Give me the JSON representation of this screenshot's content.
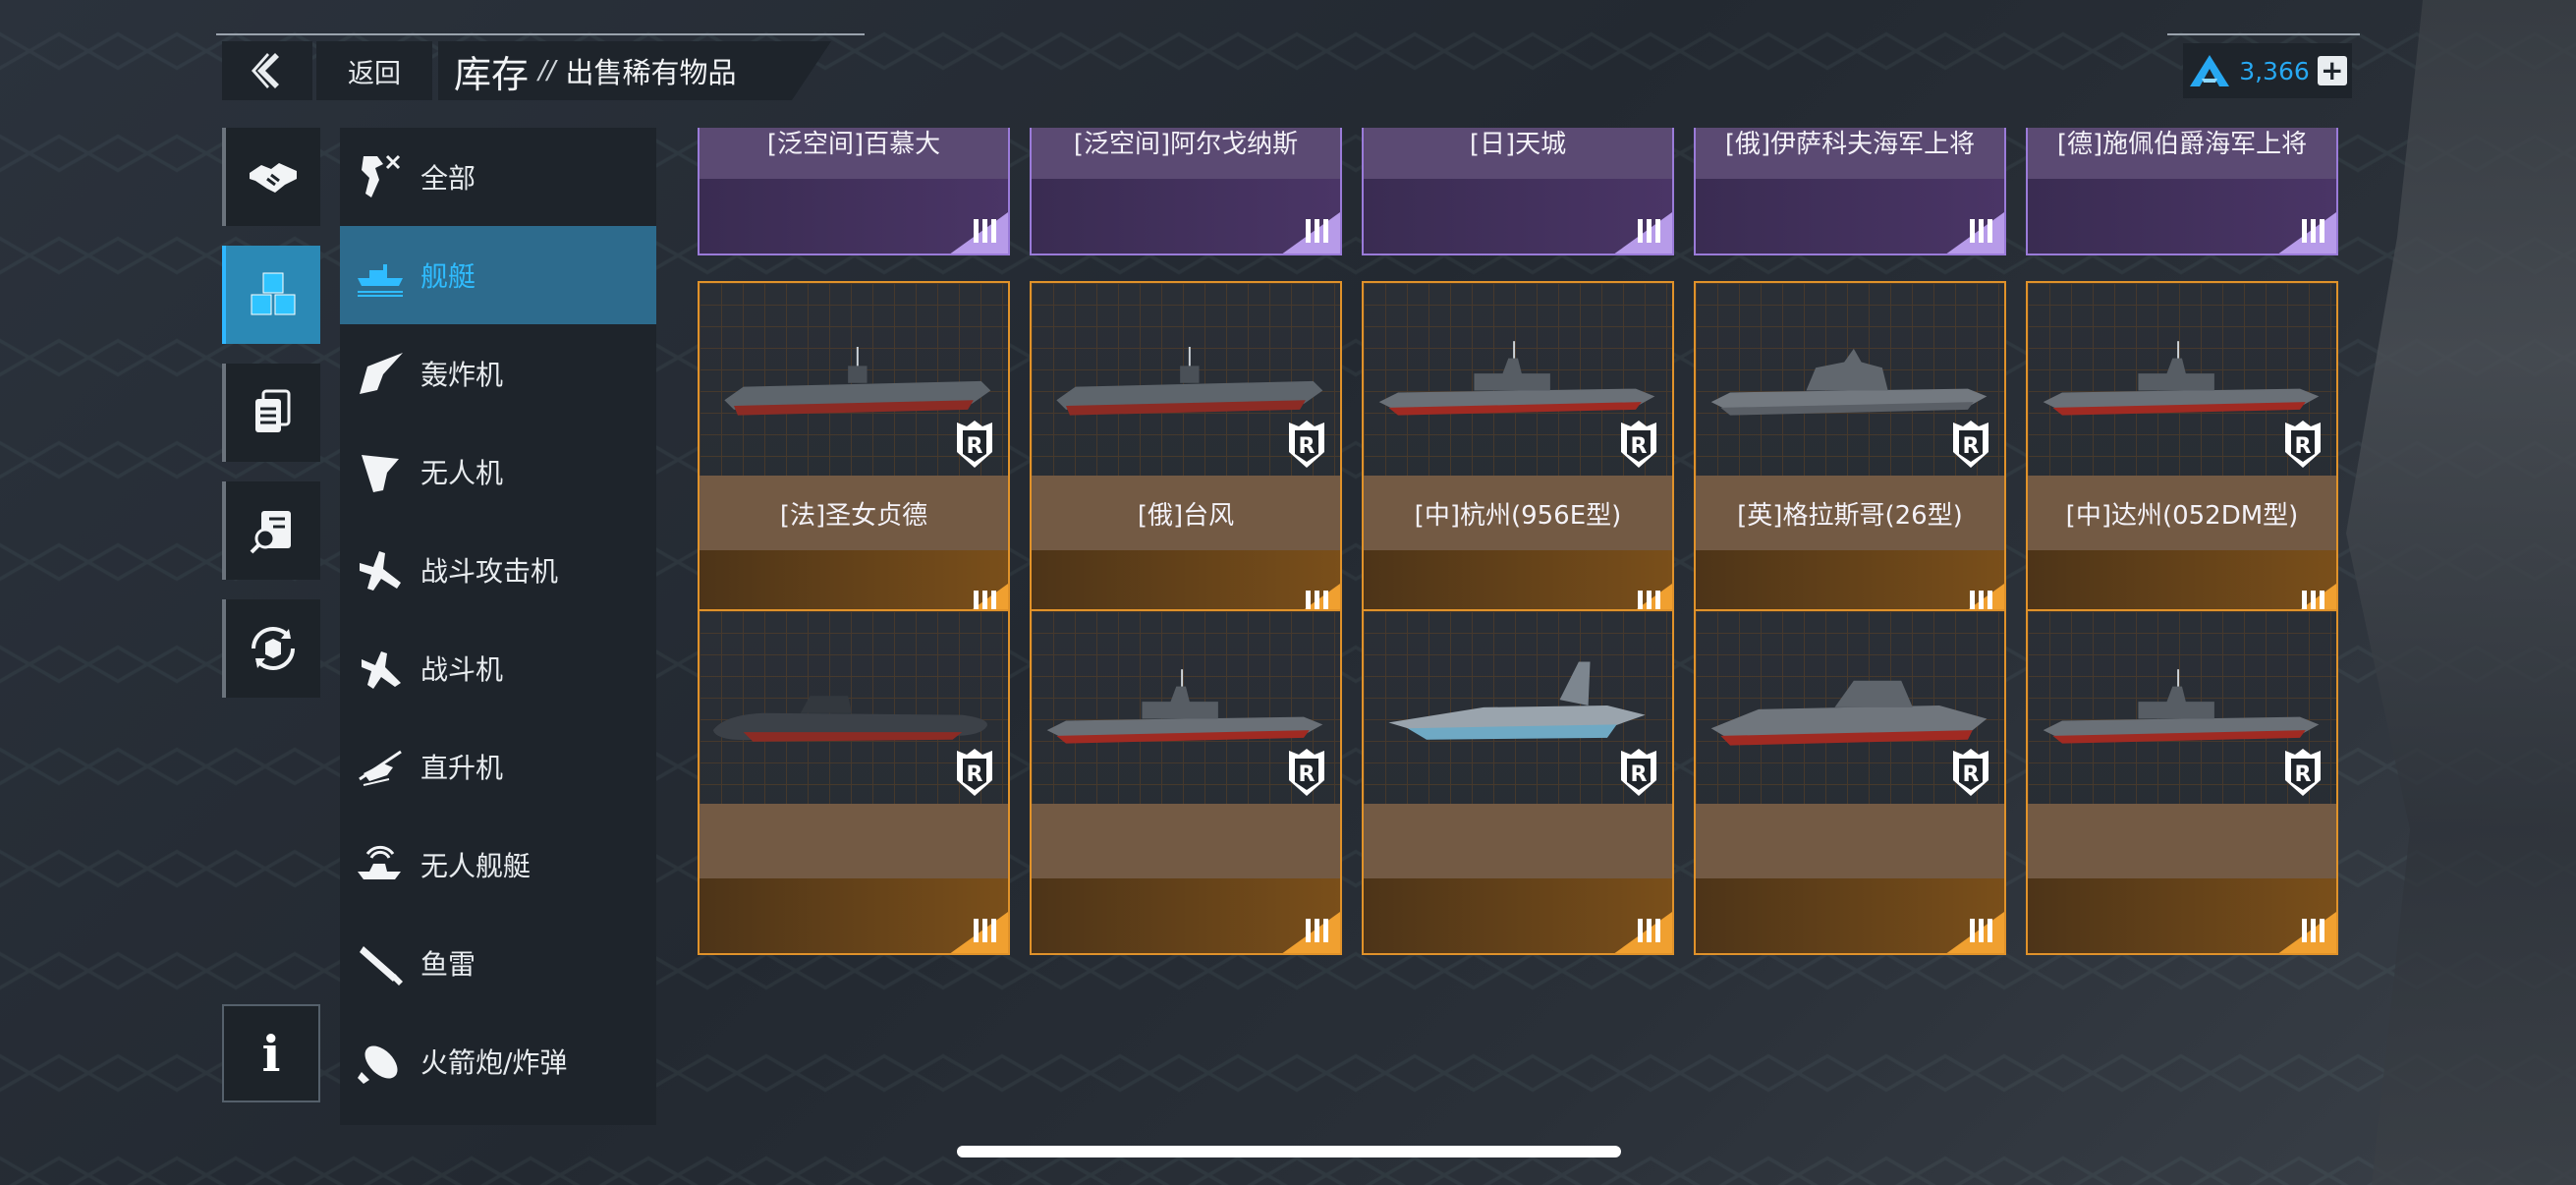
{
  "header": {
    "back_label": "返回",
    "title": "库存",
    "separator": "//",
    "subtitle": "出售稀有物品",
    "currency_value": "3,366",
    "plus_label": "+"
  },
  "icon_tabs": [
    {
      "name": "handshake-icon",
      "active": false
    },
    {
      "name": "cubes-icon",
      "active": true
    },
    {
      "name": "cards-icon",
      "active": false
    },
    {
      "name": "search-doc-icon",
      "active": false
    },
    {
      "name": "recycle-box-icon",
      "active": false
    }
  ],
  "info_label": "i",
  "categories": [
    {
      "label": "全部",
      "icon": "all-icon",
      "active": false
    },
    {
      "label": "舰艇",
      "icon": "warship-icon",
      "active": true
    },
    {
      "label": "轰炸机",
      "icon": "bomber-icon",
      "active": false
    },
    {
      "label": "无人机",
      "icon": "drone-icon",
      "active": false
    },
    {
      "label": "战斗攻击机",
      "icon": "attack-jet-icon",
      "active": false
    },
    {
      "label": "战斗机",
      "icon": "fighter-icon",
      "active": false
    },
    {
      "label": "直升机",
      "icon": "helicopter-icon",
      "active": false
    },
    {
      "label": "无人舰艇",
      "icon": "unmanned-boat-icon",
      "active": false
    },
    {
      "label": "鱼雷",
      "icon": "torpedo-icon",
      "active": false
    },
    {
      "label": "火箭炮/炸弹",
      "icon": "rocket-bomb-icon",
      "active": false
    }
  ],
  "rows": [
    {
      "rarity": "purple",
      "items": [
        {
          "name": "[泛空间]百慕大",
          "ship": "stealth-ship"
        },
        {
          "name": "[泛空间]阿尔戈纳斯",
          "ship": "ekranoplan"
        },
        {
          "name": "[日]天城",
          "ship": "battleship"
        },
        {
          "name": "[俄]伊萨科夫海军上将",
          "ship": "cruiser"
        },
        {
          "name": "[德]施佩伯爵海军上将",
          "ship": "cruiser"
        }
      ]
    },
    {
      "rarity": "gold",
      "items": [
        {
          "name": "[法]圣女贞德",
          "ship": "carrier"
        },
        {
          "name": "[俄]台风",
          "ship": "carrier"
        },
        {
          "name": "[中]杭州(956E型)",
          "ship": "destroyer"
        },
        {
          "name": "[英]格拉斯哥(26型)",
          "ship": "frigate"
        },
        {
          "name": "[中]达州(052DM型)",
          "ship": "destroyer"
        }
      ]
    },
    {
      "rarity": "gold",
      "items": [
        {
          "name": "",
          "ship": "submarine"
        },
        {
          "name": "",
          "ship": "destroyer"
        },
        {
          "name": "",
          "ship": "hovercraft"
        },
        {
          "name": "",
          "ship": "zumwalt"
        },
        {
          "name": "",
          "ship": "destroyer"
        }
      ]
    }
  ],
  "tier_label": "III",
  "colors": {
    "accent_blue": "#2fb7ff",
    "purple_border": "#9a7bd9",
    "gold_border": "#e0922a"
  }
}
